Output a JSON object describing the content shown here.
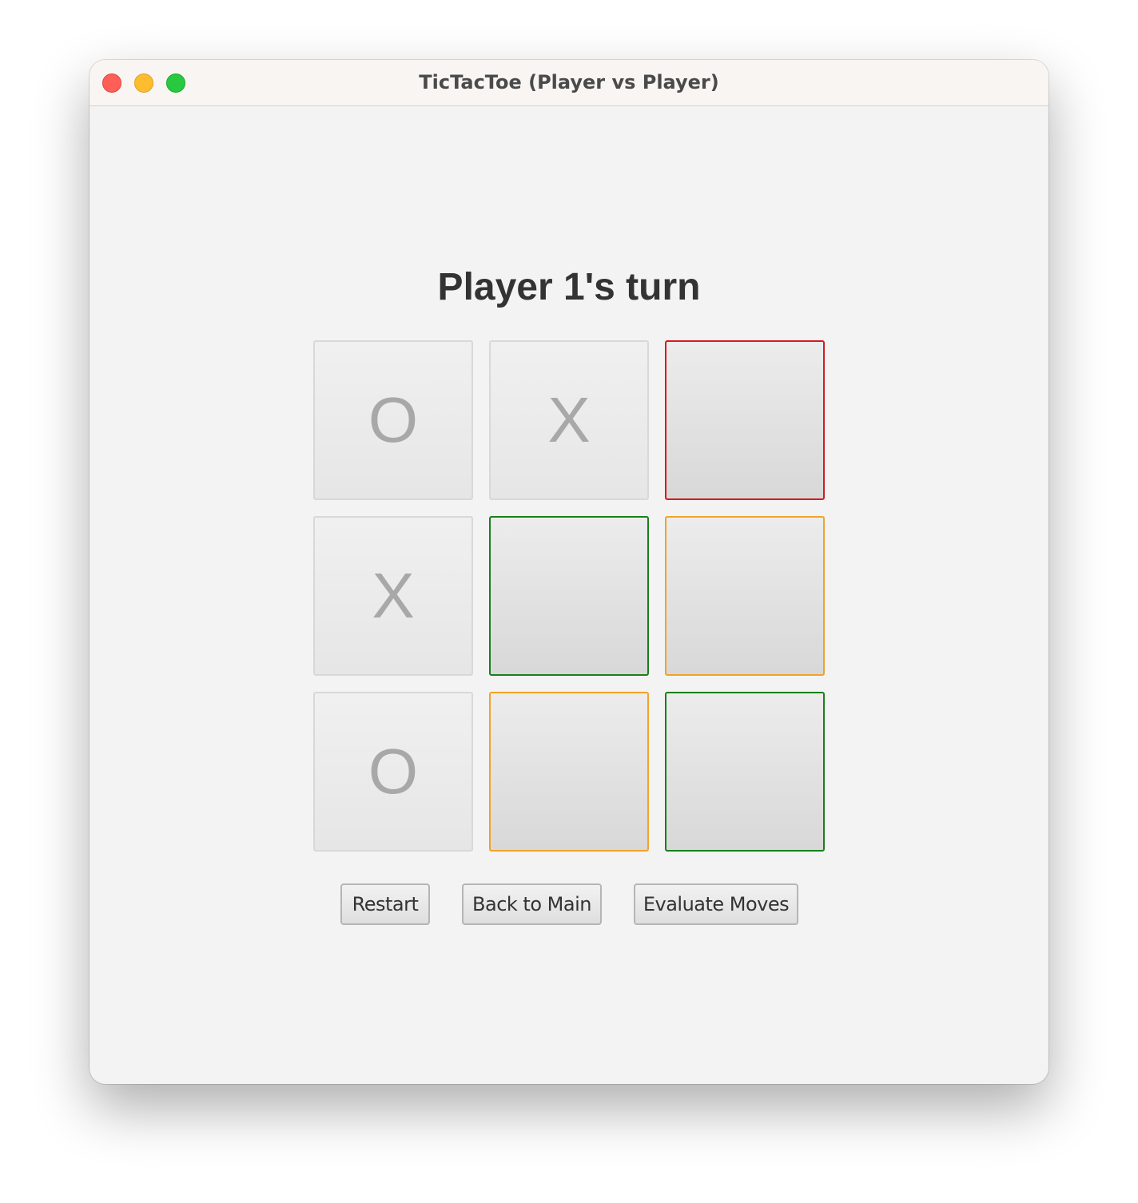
{
  "window": {
    "title": "TicTacToe (Player vs Player)"
  },
  "status": "Player 1's turn",
  "board": [
    {
      "mark": "O",
      "highlight": "none"
    },
    {
      "mark": "X",
      "highlight": "none"
    },
    {
      "mark": "",
      "highlight": "red"
    },
    {
      "mark": "X",
      "highlight": "none"
    },
    {
      "mark": "",
      "highlight": "green"
    },
    {
      "mark": "",
      "highlight": "orange"
    },
    {
      "mark": "O",
      "highlight": "none"
    },
    {
      "mark": "",
      "highlight": "orange"
    },
    {
      "mark": "",
      "highlight": "green"
    }
  ],
  "colors": {
    "red": "#d7191c",
    "green": "#1a7f1a",
    "orange": "#f0a32a"
  },
  "buttons": {
    "restart": "Restart",
    "back_to_main": "Back to Main",
    "evaluate_moves": "Evaluate Moves"
  }
}
